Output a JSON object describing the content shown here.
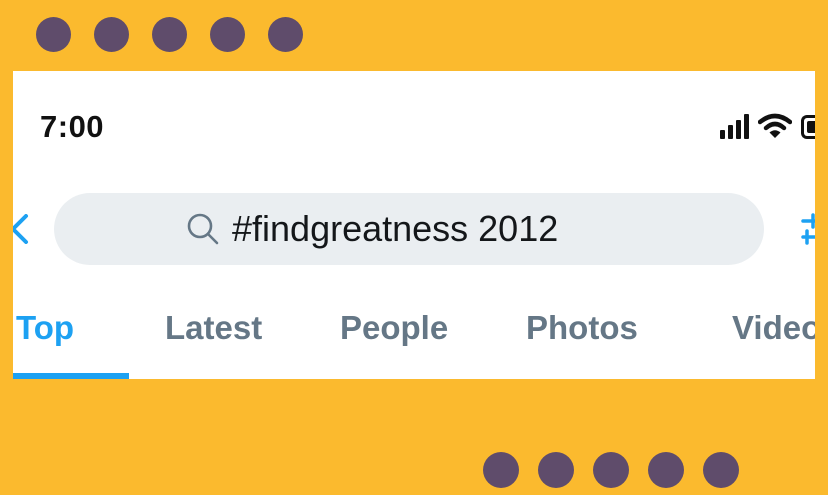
{
  "status_bar": {
    "time": "7:00",
    "icons": [
      "signal-icon",
      "wifi-icon",
      "battery-icon"
    ]
  },
  "nav": {
    "back_icon": "chevron-left-icon",
    "filter_icon": "sliders-icon"
  },
  "search": {
    "icon": "search-icon",
    "query": "#findgreatness 2012"
  },
  "tabs": [
    {
      "label": "Top",
      "active": true
    },
    {
      "label": "Latest",
      "active": false
    },
    {
      "label": "People",
      "active": false
    },
    {
      "label": "Photos",
      "active": false
    },
    {
      "label": "Videos",
      "active": false
    }
  ],
  "colors": {
    "background": "#FBBA2E",
    "dots": "#5F4C6B",
    "accent": "#1DA1F2",
    "tab_inactive": "#657786",
    "search_bg": "#EAEEF1"
  }
}
